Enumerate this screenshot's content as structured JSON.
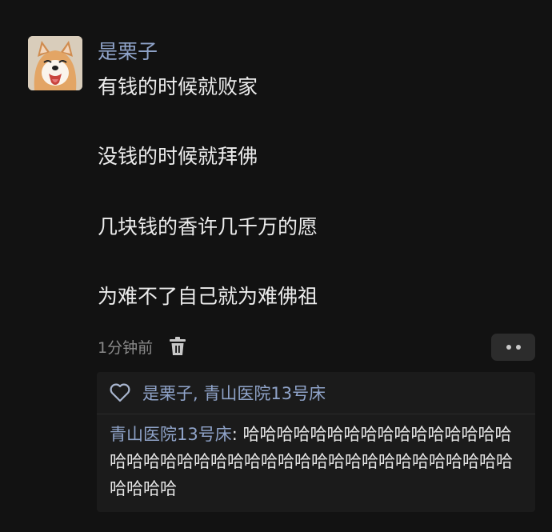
{
  "post": {
    "avatar_icon": "shiba-dog-avatar",
    "username": "是栗子",
    "lines": [
      "有钱的时候就败家",
      "没钱的时候就拜佛",
      "几块钱的香许几千万的愿",
      "为难不了自己就为难佛祖"
    ],
    "time": "1分钟前",
    "delete_icon": "trash-icon",
    "more_icon": "more-dots-icon"
  },
  "likes": {
    "icon": "heart-outline-icon",
    "names": "是栗子, 青山医院13号床"
  },
  "reply": {
    "author": "青山医院13号床",
    "separator": ": ",
    "text": "哈哈哈哈哈哈哈哈哈哈哈哈哈哈哈哈哈哈哈哈哈哈哈哈哈哈哈哈哈哈哈哈哈哈哈哈哈哈哈哈哈哈哈哈"
  },
  "colors": {
    "background": "#121212",
    "username": "#8fa3c9",
    "text": "#ececec",
    "muted": "#8a8a8a",
    "reply_bg": "#1b1b1b",
    "button_bg": "#2c2c2c"
  }
}
